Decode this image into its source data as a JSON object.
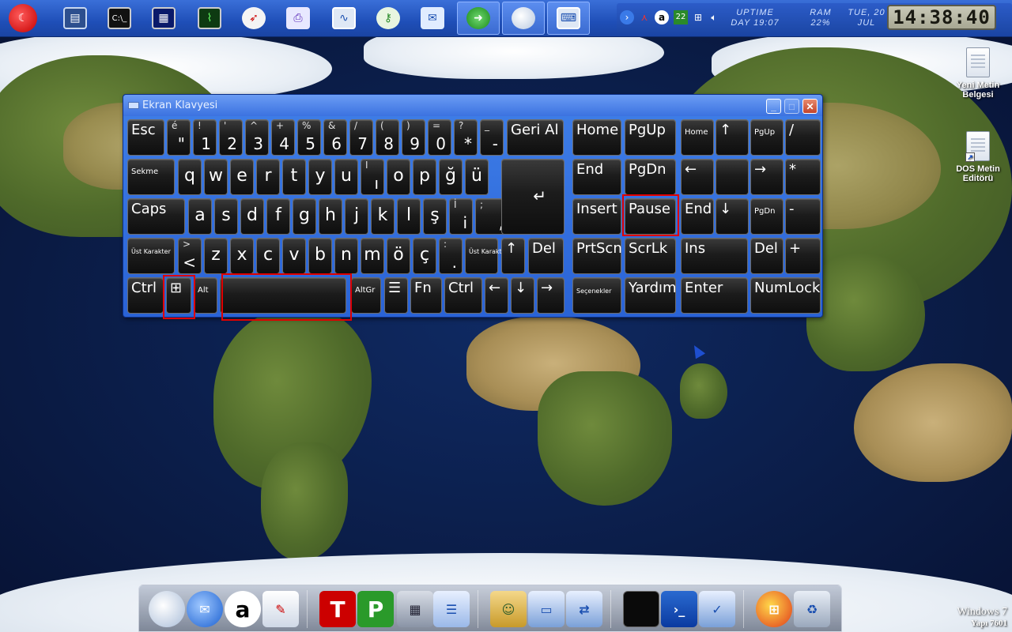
{
  "colors": {
    "taskbar": "#1f4fb8",
    "window_frame": "#2a63d6",
    "key_face": "#1c1c1c",
    "key_text": "#ffffff",
    "highlight": "#e00000"
  },
  "topbar": {
    "apps": [
      {
        "icon": "turkey-flag-start-icon"
      },
      {
        "icon": "my-computer-icon"
      },
      {
        "icon": "command-prompt-icon"
      },
      {
        "icon": "terminal-blue-icon"
      },
      {
        "icon": "system-monitor-icon"
      },
      {
        "icon": "compass-icon"
      },
      {
        "icon": "printer-window-icon"
      },
      {
        "icon": "performance-monitor-icon"
      },
      {
        "icon": "key-security-icon"
      },
      {
        "icon": "network-fax-icon"
      },
      {
        "icon": "refresh-arrow-icon"
      },
      {
        "icon": "globe-moon-icon"
      },
      {
        "icon": "onscreen-keyboard-icon"
      }
    ],
    "tray": {
      "badge": "22",
      "uptime_label": "UPTIME",
      "uptime_value": "DAY 19:07",
      "ram_label": "RAM",
      "ram_value": "22%",
      "date_line1": "TUE, 20",
      "date_line2": "JUL",
      "clock": "14:38:40"
    }
  },
  "desktop_icons": [
    {
      "label": "Yeni Metin Belgesi"
    },
    {
      "label": "DOS Metin Editörü"
    }
  ],
  "keyboard": {
    "title": "Ekran Klavyesi",
    "rows": [
      [
        {
          "main": "Esc"
        },
        {
          "shift": "é",
          "low": "\""
        },
        {
          "shift": "!",
          "low": "1"
        },
        {
          "shift": "'",
          "low": "2"
        },
        {
          "shift": "^",
          "low": "3"
        },
        {
          "shift": "+",
          "low": "4"
        },
        {
          "shift": "%",
          "low": "5"
        },
        {
          "shift": "&",
          "low": "6"
        },
        {
          "shift": "/",
          "low": "7"
        },
        {
          "shift": "(",
          "low": "8"
        },
        {
          "shift": ")",
          "low": "9"
        },
        {
          "shift": "=",
          "low": "0"
        },
        {
          "shift": "?",
          "low": "*"
        },
        {
          "shift": "_",
          "low": "-"
        },
        {
          "main": "Geri Al"
        },
        {
          "main": "Home"
        },
        {
          "main": "PgUp"
        },
        {
          "main": "Home"
        },
        {
          "main": "↑"
        },
        {
          "main": "PgUp"
        },
        {
          "main": "/"
        }
      ],
      [
        {
          "main": "Sekme"
        },
        {
          "main": "q"
        },
        {
          "main": "w"
        },
        {
          "main": "e"
        },
        {
          "main": "r"
        },
        {
          "main": "t"
        },
        {
          "main": "y"
        },
        {
          "main": "u"
        },
        {
          "shift": "I",
          "low": "ı"
        },
        {
          "main": "o"
        },
        {
          "main": "p"
        },
        {
          "main": "ğ"
        },
        {
          "main": "ü"
        },
        {
          "main": "End"
        },
        {
          "main": "PgDn"
        },
        {
          "main": "←"
        },
        {
          "main": ""
        },
        {
          "main": "→"
        },
        {
          "main": "*"
        }
      ],
      [
        {
          "main": "Caps"
        },
        {
          "main": "a"
        },
        {
          "main": "s"
        },
        {
          "main": "d"
        },
        {
          "main": "f"
        },
        {
          "main": "g"
        },
        {
          "main": "h"
        },
        {
          "main": "j"
        },
        {
          "main": "k"
        },
        {
          "main": "l"
        },
        {
          "main": "ş"
        },
        {
          "shift": "İ",
          "low": "i"
        },
        {
          "shift": ";",
          "low": ","
        },
        {
          "main": "Insert"
        },
        {
          "main": "Pause"
        },
        {
          "main": "End"
        },
        {
          "main": "↓"
        },
        {
          "main": "PgDn"
        },
        {
          "main": "-"
        }
      ],
      [
        {
          "main": "Üst Karakter"
        },
        {
          "shift": ">",
          "low": "<"
        },
        {
          "main": "z"
        },
        {
          "main": "x"
        },
        {
          "main": "c"
        },
        {
          "main": "v"
        },
        {
          "main": "b"
        },
        {
          "main": "n"
        },
        {
          "main": "m"
        },
        {
          "main": "ö"
        },
        {
          "main": "ç"
        },
        {
          "shift": ":",
          "low": "."
        },
        {
          "main": "Üst Karakter"
        },
        {
          "main": "↑"
        },
        {
          "main": "Del"
        },
        {
          "main": "PrtScn"
        },
        {
          "main": "ScrLk"
        },
        {
          "main": "Ins"
        },
        {
          "main": "Del"
        },
        {
          "main": "+"
        }
      ],
      [
        {
          "main": "Ctrl"
        },
        {
          "main": "⊞"
        },
        {
          "main": "Alt"
        },
        {
          "main": ""
        },
        {
          "main": "AltGr"
        },
        {
          "main": "☰"
        },
        {
          "main": "Fn"
        },
        {
          "main": "Ctrl"
        },
        {
          "main": "←"
        },
        {
          "main": "↓"
        },
        {
          "main": "→"
        },
        {
          "main": "Seçenekler"
        },
        {
          "main": "Yardım"
        },
        {
          "main": "Enter"
        },
        {
          "main": "NumLock"
        }
      ]
    ]
  },
  "dock": {
    "items": [
      {
        "icon": "globe-icon"
      },
      {
        "icon": "mail-globe-icon"
      },
      {
        "icon": "avast-icon"
      },
      {
        "icon": "paint-brush-icon"
      },
      {
        "icon": "text-editor-free-icon",
        "badge": "T"
      },
      {
        "icon": "presentation-free-icon",
        "badge": "P"
      },
      {
        "icon": "calculator-icon"
      },
      {
        "icon": "notepad-icon"
      },
      {
        "icon": "user-folder-icon"
      },
      {
        "icon": "network-computer-icon"
      },
      {
        "icon": "network-icon"
      },
      {
        "icon": "black-terminal-icon"
      },
      {
        "icon": "powershell-icon"
      },
      {
        "icon": "control-panel-icon"
      },
      {
        "icon": "windows-update-icon"
      },
      {
        "icon": "recycle-bin-icon"
      }
    ]
  },
  "watermark": {
    "line1": "Windows 7",
    "line2": "Yapı 7601"
  }
}
